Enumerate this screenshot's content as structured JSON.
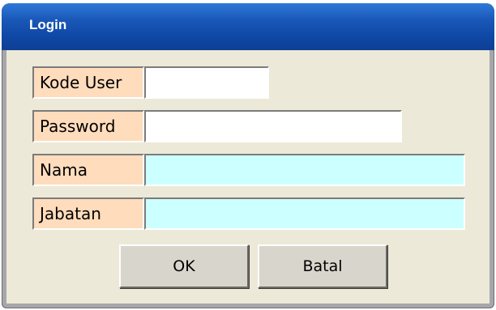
{
  "window": {
    "title": "Login"
  },
  "form": {
    "kode_user": {
      "label": "Kode User",
      "value": ""
    },
    "password": {
      "label": "Password",
      "value": ""
    },
    "nama": {
      "label": "Nama",
      "value": ""
    },
    "jabatan": {
      "label": "Jabatan",
      "value": ""
    }
  },
  "buttons": {
    "ok": "OK",
    "batal": "Batal"
  },
  "colors": {
    "titlebar": "#1a58b8",
    "label_bg": "#ffdcbc",
    "readonly_field_bg": "#ccffff",
    "dialog_bg": "#ece9d8"
  }
}
